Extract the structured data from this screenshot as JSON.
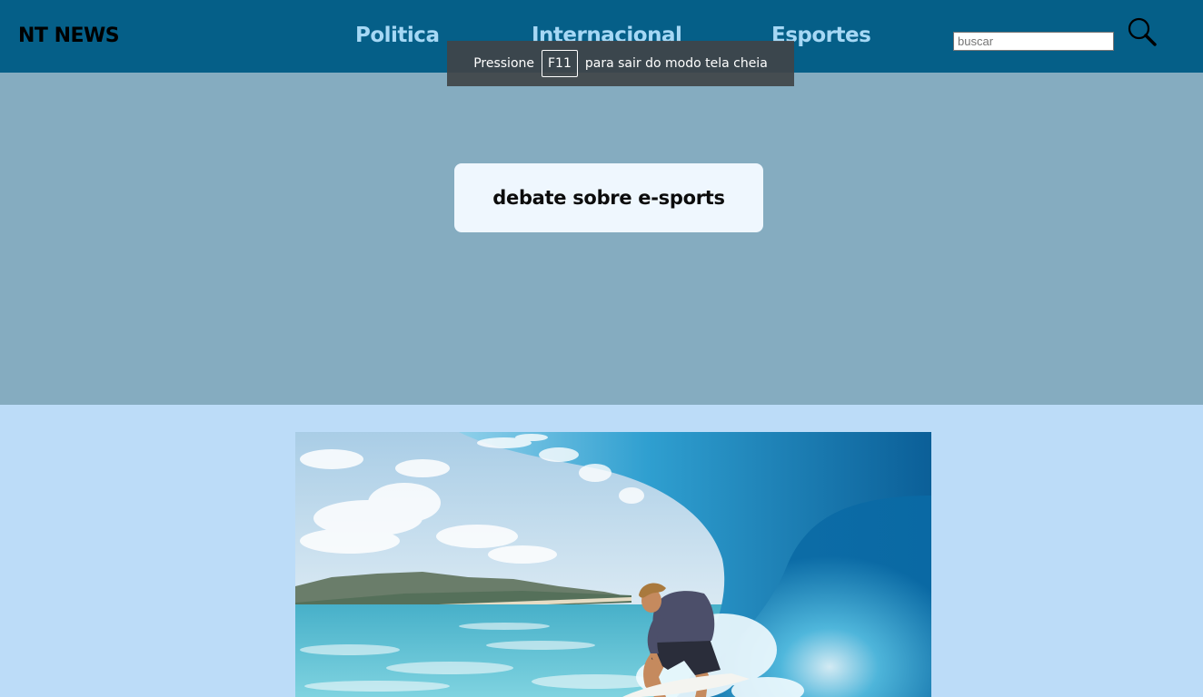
{
  "header": {
    "logo": "NT NEWS",
    "nav": [
      {
        "label": "Politica"
      },
      {
        "label": "Internacional"
      },
      {
        "label": "Esportes"
      }
    ],
    "search": {
      "placeholder": "buscar",
      "value": "",
      "icon": "search-icon"
    }
  },
  "fullscreen_toast": {
    "prefix": "Pressione",
    "key": "F11",
    "suffix": "para sair do modo tela cheia"
  },
  "hero": {
    "headline": "debate sobre e-sports"
  },
  "colors": {
    "header_bg": "#055f88",
    "nav_text": "#a6d8f5",
    "hero_bg": "#85acc0",
    "card_bg": "#eff7fe",
    "page_bg": "#bcdcf8"
  }
}
